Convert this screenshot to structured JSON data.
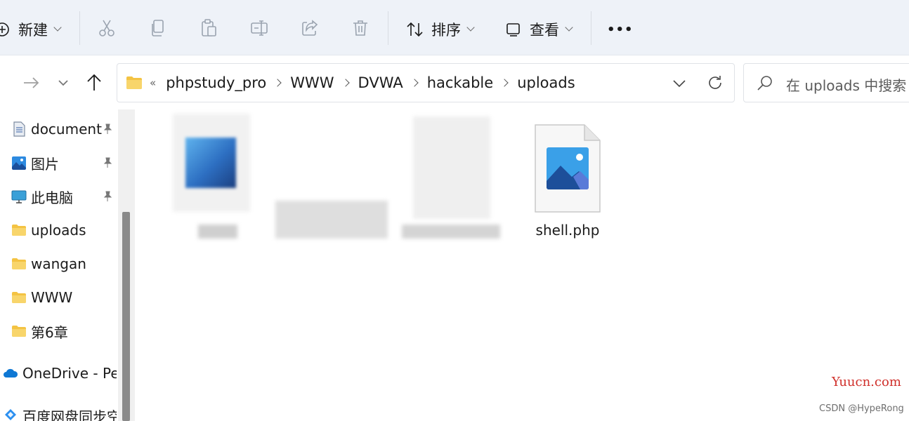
{
  "toolbar": {
    "new_label": "新建",
    "sort_label": "排序",
    "view_label": "查看",
    "more_label": "•••"
  },
  "address": {
    "overflow": "«",
    "crumbs": [
      "phpstudy_pro",
      "WWW",
      "DVWA",
      "hackable",
      "uploads"
    ]
  },
  "search": {
    "placeholder": "在 uploads 中搜索"
  },
  "sidebar": {
    "items": [
      {
        "label": "document",
        "icon": "document-icon",
        "pinned": true
      },
      {
        "label": "图片",
        "icon": "pictures-icon",
        "pinned": true
      },
      {
        "label": "此电脑",
        "icon": "monitor-icon",
        "pinned": true
      },
      {
        "label": "uploads",
        "icon": "folder-icon",
        "pinned": false
      },
      {
        "label": "wangan",
        "icon": "folder-icon",
        "pinned": false
      },
      {
        "label": "WWW",
        "icon": "folder-icon",
        "pinned": false
      },
      {
        "label": "第6章",
        "icon": "folder-icon",
        "pinned": false
      },
      {
        "label": "OneDrive - Pe",
        "icon": "onedrive-icon",
        "pinned": false
      },
      {
        "label": "百度网盘同步空",
        "icon": "baidu-netdisk-icon",
        "pinned": false
      }
    ]
  },
  "files": [
    {
      "name": "shell.php",
      "icon": "image-file-icon"
    }
  ],
  "watermarks": {
    "site": "Yuucn.com",
    "author": "CSDN @HypeRong"
  },
  "colors": {
    "folder": "#f4c343",
    "accent": "#0f6cbd",
    "watermark_red": "#d0302b"
  }
}
